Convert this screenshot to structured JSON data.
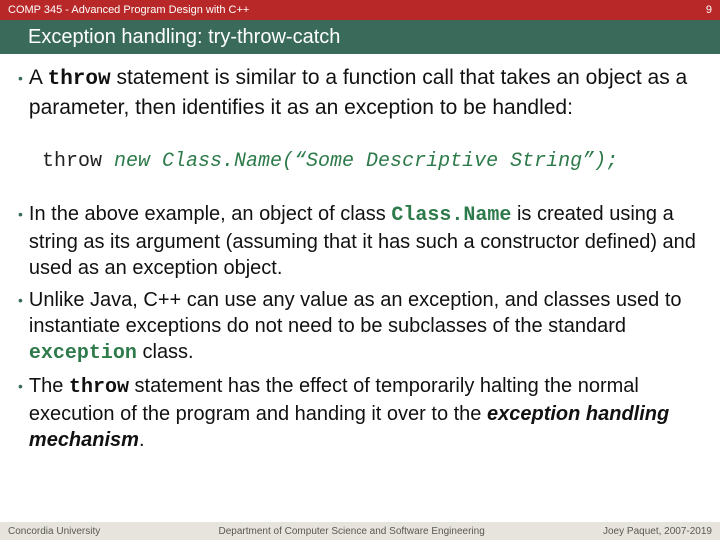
{
  "header": {
    "course": "COMP 345 - Advanced Program Design with C++",
    "slide_no": "9",
    "title": "Exception handling: try-throw-catch"
  },
  "bullets1": {
    "b1_pre": "A ",
    "b1_kw": "throw",
    "b1_post": " statement is similar to a function call that takes an object as a parameter, then identifies it as an exception to be handled:"
  },
  "code": {
    "kw": "throw ",
    "rest": "new Class.Name(“Some Descriptive String”);"
  },
  "bullets2": {
    "b1_pre": "In the above example, an object of class ",
    "b1_kw": "Class.Name",
    "b1_post": " is created using a string as its argument (assuming that it has such a constructor defined) and used as an exception object.",
    "b2_pre": "Unlike Java, C++ can use any value as an exception, and classes used to instantiate exceptions do not need to be subclasses of the standard ",
    "b2_kw": "exception",
    "b2_post": " class.",
    "b3_pre": "The ",
    "b3_kw": "throw",
    "b3_mid": " statement has the effect of temporarily halting the normal execution of the program and handing it over to the ",
    "b3_em": "exception handling mechanism",
    "b3_post": "."
  },
  "footer": {
    "left": "Concordia University",
    "center": "Department of Computer Science and Software Engineering",
    "right": "Joey Paquet, 2007-2019"
  }
}
